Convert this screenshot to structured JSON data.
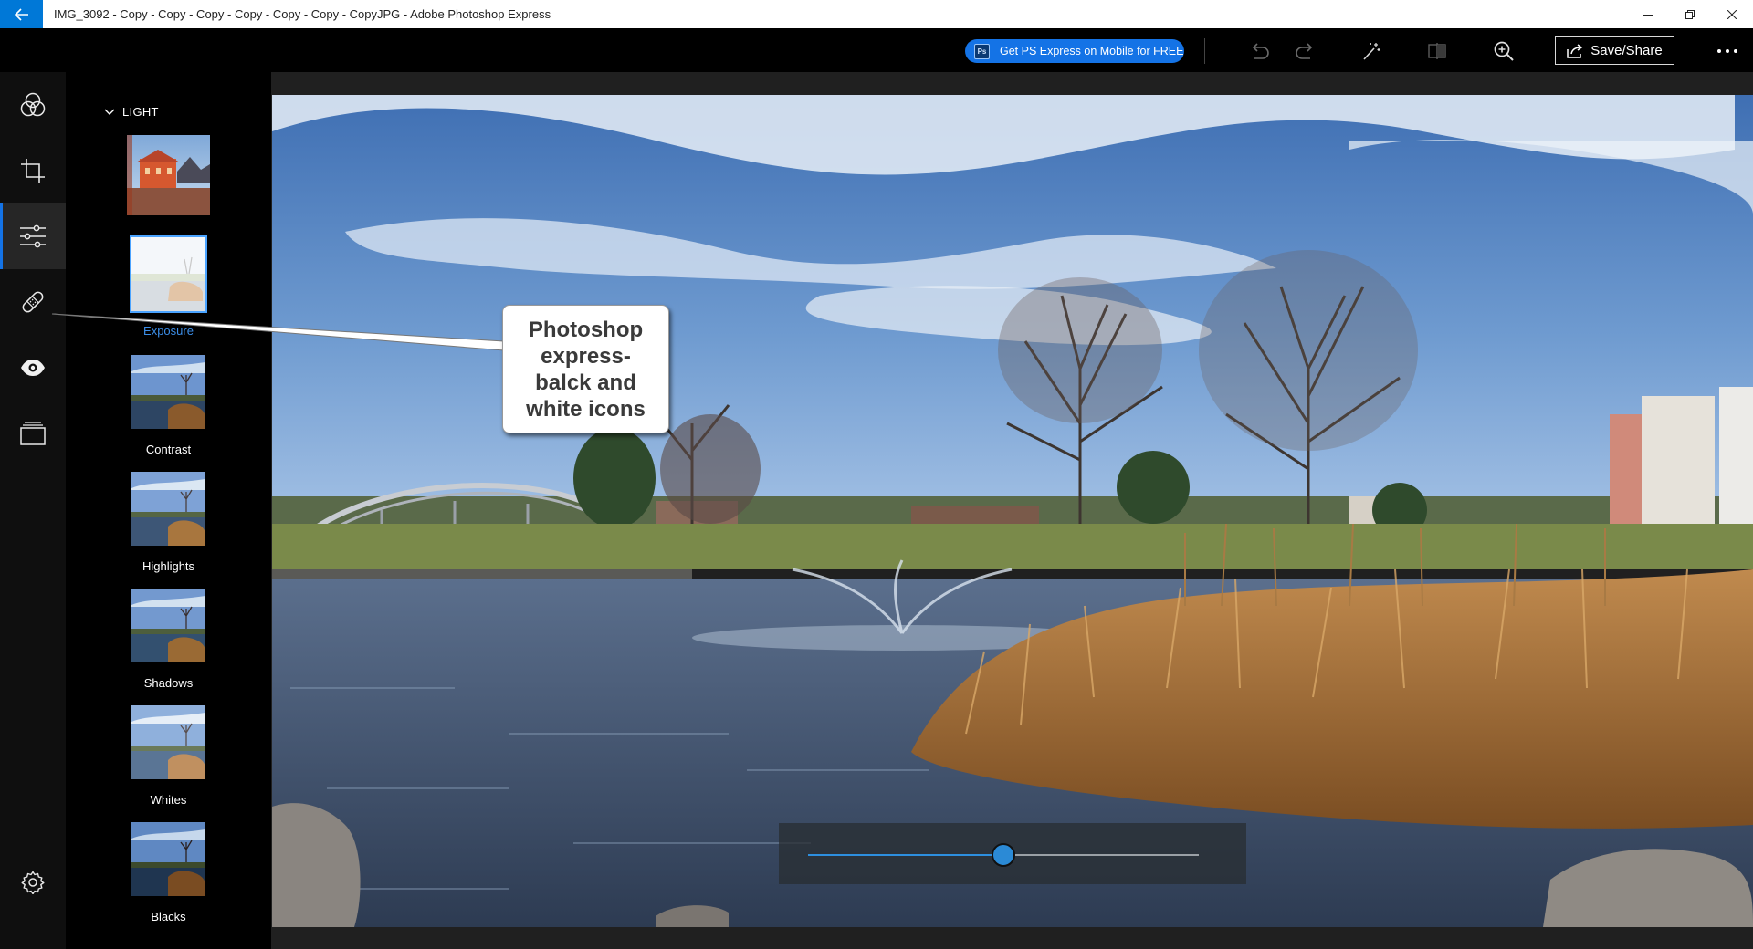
{
  "window": {
    "title": "IMG_3092 - Copy - Copy - Copy - Copy - Copy - Copy - CopyJPG - Adobe Photoshop Express"
  },
  "toolbar": {
    "promo_label": "Get PS Express on Mobile for FREE",
    "promo_badge": "Ps",
    "save_label": "Save/Share"
  },
  "rail": {
    "items": [
      "looks-icon",
      "crop-icon",
      "adjustments-icon",
      "healing-icon",
      "eye-icon",
      "borders-icon"
    ],
    "active": "adjustments-icon",
    "bottom": "settings-icon"
  },
  "panel": {
    "section_title": "LIGHT",
    "items": [
      {
        "label": "",
        "selected": false
      },
      {
        "label": "Exposure",
        "selected": true
      },
      {
        "label": "Contrast",
        "selected": false
      },
      {
        "label": "Highlights",
        "selected": false
      },
      {
        "label": "Shadows",
        "selected": false
      },
      {
        "label": "Whites",
        "selected": false
      },
      {
        "label": "Blacks",
        "selected": false
      }
    ]
  },
  "slider": {
    "value_fraction": 0.5
  },
  "callout": {
    "text": "Photoshop express- balck and white icons"
  },
  "colors": {
    "accent": "#1473e6",
    "selected_label": "#3c8ee8",
    "rail_bg": "#0f0f0f"
  }
}
